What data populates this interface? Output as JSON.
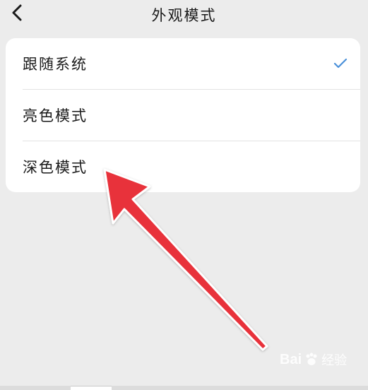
{
  "header": {
    "title": "外观模式",
    "back_icon": "chevron-left-icon"
  },
  "options": [
    {
      "label": "跟随系统",
      "selected": true
    },
    {
      "label": "亮色模式",
      "selected": false
    },
    {
      "label": "深色模式",
      "selected": false
    }
  ],
  "check_icon": "checkmark-icon",
  "colors": {
    "background": "#ececec",
    "card": "#ffffff",
    "accent": "#4a90d9",
    "arrow": "#e8303a"
  },
  "annotation": {
    "icon": "red-arrow-icon",
    "points_to": "深色模式"
  },
  "watermark": {
    "text": "Bai",
    "sub": "经验",
    "icon": "baidu-paw-icon"
  }
}
